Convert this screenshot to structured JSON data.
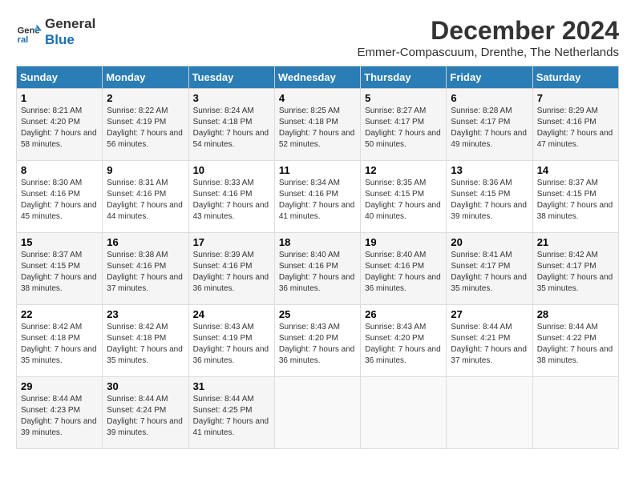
{
  "header": {
    "logo_line1": "General",
    "logo_line2": "Blue",
    "month_title": "December 2024",
    "subtitle": "Emmer-Compascuum, Drenthe, The Netherlands"
  },
  "days_of_week": [
    "Sunday",
    "Monday",
    "Tuesday",
    "Wednesday",
    "Thursday",
    "Friday",
    "Saturday"
  ],
  "weeks": [
    [
      {
        "day": "1",
        "sunrise": "Sunrise: 8:21 AM",
        "sunset": "Sunset: 4:20 PM",
        "daylight": "Daylight: 7 hours and 58 minutes."
      },
      {
        "day": "2",
        "sunrise": "Sunrise: 8:22 AM",
        "sunset": "Sunset: 4:19 PM",
        "daylight": "Daylight: 7 hours and 56 minutes."
      },
      {
        "day": "3",
        "sunrise": "Sunrise: 8:24 AM",
        "sunset": "Sunset: 4:18 PM",
        "daylight": "Daylight: 7 hours and 54 minutes."
      },
      {
        "day": "4",
        "sunrise": "Sunrise: 8:25 AM",
        "sunset": "Sunset: 4:18 PM",
        "daylight": "Daylight: 7 hours and 52 minutes."
      },
      {
        "day": "5",
        "sunrise": "Sunrise: 8:27 AM",
        "sunset": "Sunset: 4:17 PM",
        "daylight": "Daylight: 7 hours and 50 minutes."
      },
      {
        "day": "6",
        "sunrise": "Sunrise: 8:28 AM",
        "sunset": "Sunset: 4:17 PM",
        "daylight": "Daylight: 7 hours and 49 minutes."
      },
      {
        "day": "7",
        "sunrise": "Sunrise: 8:29 AM",
        "sunset": "Sunset: 4:16 PM",
        "daylight": "Daylight: 7 hours and 47 minutes."
      }
    ],
    [
      {
        "day": "8",
        "sunrise": "Sunrise: 8:30 AM",
        "sunset": "Sunset: 4:16 PM",
        "daylight": "Daylight: 7 hours and 45 minutes."
      },
      {
        "day": "9",
        "sunrise": "Sunrise: 8:31 AM",
        "sunset": "Sunset: 4:16 PM",
        "daylight": "Daylight: 7 hours and 44 minutes."
      },
      {
        "day": "10",
        "sunrise": "Sunrise: 8:33 AM",
        "sunset": "Sunset: 4:16 PM",
        "daylight": "Daylight: 7 hours and 43 minutes."
      },
      {
        "day": "11",
        "sunrise": "Sunrise: 8:34 AM",
        "sunset": "Sunset: 4:16 PM",
        "daylight": "Daylight: 7 hours and 41 minutes."
      },
      {
        "day": "12",
        "sunrise": "Sunrise: 8:35 AM",
        "sunset": "Sunset: 4:15 PM",
        "daylight": "Daylight: 7 hours and 40 minutes."
      },
      {
        "day": "13",
        "sunrise": "Sunrise: 8:36 AM",
        "sunset": "Sunset: 4:15 PM",
        "daylight": "Daylight: 7 hours and 39 minutes."
      },
      {
        "day": "14",
        "sunrise": "Sunrise: 8:37 AM",
        "sunset": "Sunset: 4:15 PM",
        "daylight": "Daylight: 7 hours and 38 minutes."
      }
    ],
    [
      {
        "day": "15",
        "sunrise": "Sunrise: 8:37 AM",
        "sunset": "Sunset: 4:15 PM",
        "daylight": "Daylight: 7 hours and 38 minutes."
      },
      {
        "day": "16",
        "sunrise": "Sunrise: 8:38 AM",
        "sunset": "Sunset: 4:16 PM",
        "daylight": "Daylight: 7 hours and 37 minutes."
      },
      {
        "day": "17",
        "sunrise": "Sunrise: 8:39 AM",
        "sunset": "Sunset: 4:16 PM",
        "daylight": "Daylight: 7 hours and 36 minutes."
      },
      {
        "day": "18",
        "sunrise": "Sunrise: 8:40 AM",
        "sunset": "Sunset: 4:16 PM",
        "daylight": "Daylight: 7 hours and 36 minutes."
      },
      {
        "day": "19",
        "sunrise": "Sunrise: 8:40 AM",
        "sunset": "Sunset: 4:16 PM",
        "daylight": "Daylight: 7 hours and 36 minutes."
      },
      {
        "day": "20",
        "sunrise": "Sunrise: 8:41 AM",
        "sunset": "Sunset: 4:17 PM",
        "daylight": "Daylight: 7 hours and 35 minutes."
      },
      {
        "day": "21",
        "sunrise": "Sunrise: 8:42 AM",
        "sunset": "Sunset: 4:17 PM",
        "daylight": "Daylight: 7 hours and 35 minutes."
      }
    ],
    [
      {
        "day": "22",
        "sunrise": "Sunrise: 8:42 AM",
        "sunset": "Sunset: 4:18 PM",
        "daylight": "Daylight: 7 hours and 35 minutes."
      },
      {
        "day": "23",
        "sunrise": "Sunrise: 8:42 AM",
        "sunset": "Sunset: 4:18 PM",
        "daylight": "Daylight: 7 hours and 35 minutes."
      },
      {
        "day": "24",
        "sunrise": "Sunrise: 8:43 AM",
        "sunset": "Sunset: 4:19 PM",
        "daylight": "Daylight: 7 hours and 36 minutes."
      },
      {
        "day": "25",
        "sunrise": "Sunrise: 8:43 AM",
        "sunset": "Sunset: 4:20 PM",
        "daylight": "Daylight: 7 hours and 36 minutes."
      },
      {
        "day": "26",
        "sunrise": "Sunrise: 8:43 AM",
        "sunset": "Sunset: 4:20 PM",
        "daylight": "Daylight: 7 hours and 36 minutes."
      },
      {
        "day": "27",
        "sunrise": "Sunrise: 8:44 AM",
        "sunset": "Sunset: 4:21 PM",
        "daylight": "Daylight: 7 hours and 37 minutes."
      },
      {
        "day": "28",
        "sunrise": "Sunrise: 8:44 AM",
        "sunset": "Sunset: 4:22 PM",
        "daylight": "Daylight: 7 hours and 38 minutes."
      }
    ],
    [
      {
        "day": "29",
        "sunrise": "Sunrise: 8:44 AM",
        "sunset": "Sunset: 4:23 PM",
        "daylight": "Daylight: 7 hours and 39 minutes."
      },
      {
        "day": "30",
        "sunrise": "Sunrise: 8:44 AM",
        "sunset": "Sunset: 4:24 PM",
        "daylight": "Daylight: 7 hours and 39 minutes."
      },
      {
        "day": "31",
        "sunrise": "Sunrise: 8:44 AM",
        "sunset": "Sunset: 4:25 PM",
        "daylight": "Daylight: 7 hours and 41 minutes."
      },
      null,
      null,
      null,
      null
    ]
  ]
}
